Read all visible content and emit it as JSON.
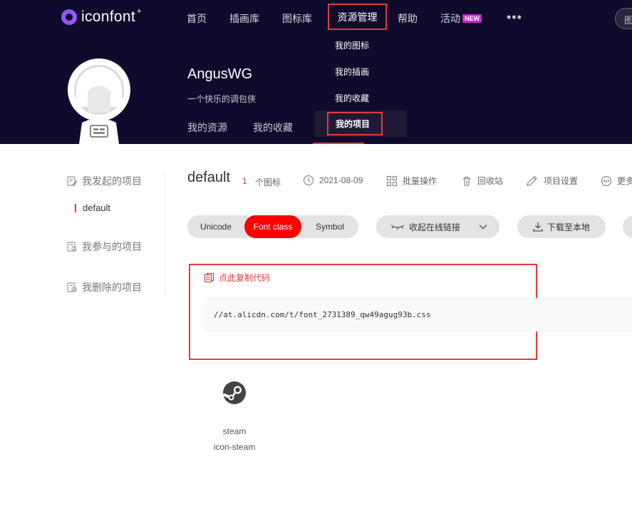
{
  "header": {
    "logo_text": "iconfont",
    "logo_sup": "+",
    "nav": [
      {
        "label": "首页"
      },
      {
        "label": "插画库"
      },
      {
        "label": "图标库"
      },
      {
        "label": "资源管理"
      },
      {
        "label": "帮助"
      },
      {
        "label": "活动",
        "badge": "NEW"
      }
    ],
    "more": "•••",
    "search_placeholder": "图"
  },
  "dropdown": {
    "items": [
      {
        "label": "我的图标"
      },
      {
        "label": "我的插画"
      },
      {
        "label": "我的收藏"
      },
      {
        "label": "我的项目"
      }
    ],
    "selected": "我的项目"
  },
  "profile": {
    "name": "AngusWG",
    "bio": "一个快乐的调包侠",
    "tabs": [
      {
        "label": "我的资源"
      },
      {
        "label": "我的收藏"
      }
    ]
  },
  "sidebar": {
    "sections": [
      {
        "label": "我发起的项目",
        "icon": "edit-doc-icon"
      },
      {
        "label": "我参与的项目",
        "icon": "search-doc-icon"
      },
      {
        "label": "我删除的项目",
        "icon": "delete-doc-icon"
      }
    ],
    "active_project": "default"
  },
  "project": {
    "title": "default",
    "count": "1",
    "count_label": "个图标",
    "date": "2021-08-09",
    "actions": [
      {
        "label": "批量操作",
        "icon": "batch-icon"
      },
      {
        "label": "回收站",
        "icon": "trash-icon"
      },
      {
        "label": "项目设置",
        "icon": "edit-icon"
      },
      {
        "label": "更多",
        "icon": "more-circle-icon"
      }
    ]
  },
  "toolbar": {
    "formats": [
      "Unicode",
      "Font class",
      "Symbol"
    ],
    "selected_format": "Font class",
    "collapse_label": "收起在线链接",
    "download_label": "下载至本地"
  },
  "code": {
    "copy_label": "点此复制代码",
    "url": "//at.alicdn.com/t/font_2731389_qw49agug93b.css"
  },
  "icons": [
    {
      "name": "steam",
      "class_name": "icon-steam",
      "glyph": "steam-icon"
    }
  ],
  "colors": {
    "header_bg": "#100a2c",
    "accent_red": "#ff0000",
    "highlight_border": "#e23b3b",
    "badge_purple": "#c52bc9"
  }
}
